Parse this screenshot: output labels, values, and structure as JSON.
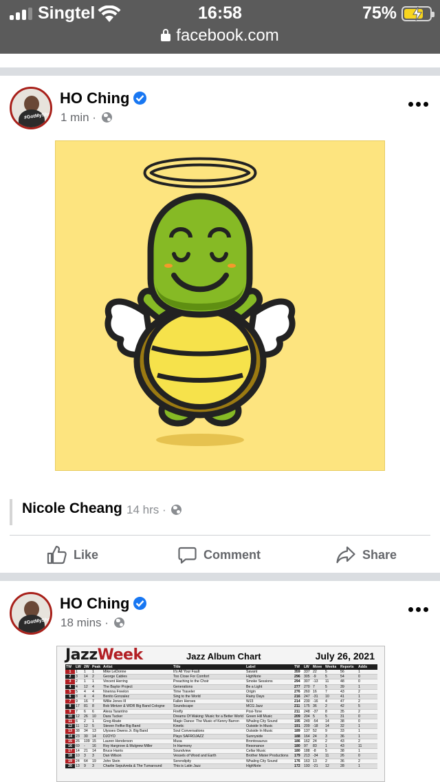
{
  "status_bar": {
    "carrier": "Singtel",
    "time": "16:58",
    "battery_percent": "75%",
    "battery_level": 0.75,
    "url": "facebook.com"
  },
  "posts": [
    {
      "author": "HO Ching",
      "timestamp": "1 min",
      "separator": " · ",
      "image_icon": "turtle-angel-illustration"
    },
    {
      "author": "HO Ching",
      "timestamp": "18 mins",
      "separator": " · "
    }
  ],
  "avatar_tag": "#GotMyShot",
  "comment": {
    "author": "Nicole Cheang",
    "timestamp": "14 hrs",
    "separator": " · "
  },
  "actions": {
    "like": "Like",
    "comment": "Comment",
    "share": "Share"
  },
  "jazz_chart": {
    "logo_part1": "Jazz",
    "logo_part2": "Week",
    "title": "Jazz Album Chart",
    "date": "July 26, 2021",
    "columns": [
      "TW",
      "LW",
      "2W",
      "Peak",
      "Artist",
      "Title",
      "Label",
      "TW",
      "LW",
      "Move",
      "Weeks",
      "Reports",
      "Adds"
    ],
    "rows": [
      [
        "1",
        "1",
        "1",
        "1",
        "Mike LeDonne",
        "It's All Your Fault",
        "Savant",
        "359",
        "337",
        "22",
        "5",
        "56",
        "1"
      ],
      [
        "2",
        "3",
        "14",
        "2",
        "George Cables",
        "Too Close For Comfort",
        "HighNote",
        "296",
        "305",
        "-9",
        "5",
        "54",
        "0"
      ],
      [
        "3",
        "2",
        "1",
        "1",
        "Vincent Herring",
        "Preaching to the Choir",
        "Smoke Sessions",
        "294",
        "307",
        "-13",
        "11",
        "48",
        "0"
      ],
      [
        "4",
        "4",
        "12",
        "4",
        "The Baylor Project",
        "Generations",
        "Be a Light",
        "277",
        "270",
        "7",
        "5",
        "39",
        "1"
      ],
      [
        "5",
        "5",
        "4",
        "4",
        "Nnenna Freelon",
        "Time Traveler",
        "Origin",
        "276",
        "260",
        "16",
        "7",
        "43",
        "2"
      ],
      [
        "6",
        "8",
        "4",
        "4",
        "Benito Gonzalez",
        "Sing to the World",
        "Rainy Days",
        "216",
        "247",
        "-31",
        "10",
        "41",
        "1"
      ],
      [
        "7",
        "9",
        "16",
        "7",
        "Willie Jones III",
        "Fallen Heroes",
        "WJ3",
        "214",
        "230",
        "-16",
        "4",
        "47",
        "2"
      ],
      [
        "8",
        "17",
        "81",
        "8",
        "Bob Mintzer & WDR Big Band Cologne",
        "Soundscape",
        "MCG Jazz",
        "211",
        "175",
        "36",
        "2",
        "42",
        "5"
      ],
      [
        "9",
        "7",
        "6",
        "6",
        "Alexa Tarantino",
        "Firefly",
        "Posi-Tone",
        "211",
        "248",
        "-37",
        "8",
        "35",
        "2"
      ],
      [
        "10",
        "12",
        "26",
        "10",
        "Dara Tucker",
        "Dreams Of Waking: Music for a Better World",
        "Green Hill Music",
        "209",
        "204",
        "5",
        "5",
        "31",
        "0"
      ],
      [
        "11",
        "6",
        "2",
        "1",
        "Greg Abate",
        "Magic Dance: The Music of Kenny Barron",
        "Whaling City Sound",
        "195",
        "249",
        "-54",
        "14",
        "38",
        "0"
      ],
      [
        "12",
        "11",
        "12",
        "5",
        "Steven Feifke Big Band",
        "Kinetic",
        "Outside In Music",
        "191",
        "209",
        "-18",
        "14",
        "32",
        "1"
      ],
      [
        "13",
        "38",
        "34",
        "13",
        "Ulysses Owens Jr. Big Band",
        "Soul Conversations",
        "Outside In Music",
        "189",
        "137",
        "52",
        "9",
        "33",
        "1"
      ],
      [
        "14",
        "23",
        "30",
        "14",
        "DJOYO",
        "Plays SAFROJAZZ",
        "Sunnyside",
        "188",
        "164",
        "24",
        "3",
        "36",
        "1"
      ],
      [
        "15",
        "26",
        "109",
        "15",
        "Lauren Henderson",
        "Musa",
        "Brontosaurus",
        "186",
        "162",
        "24",
        "2",
        "43",
        "2"
      ],
      [
        "16",
        "69",
        "-",
        "16",
        "Roy Hargrove & Mulgrew Miller",
        "In Harmony",
        "Resonance",
        "180",
        "97",
        "83",
        "1",
        "43",
        "11"
      ],
      [
        "17",
        "14",
        "21",
        "14",
        "Bruce Harris",
        "Soundview",
        "Cellar Music",
        "180",
        "188",
        "-8",
        "5",
        "38",
        "1"
      ],
      [
        "18",
        "10",
        "3",
        "3",
        "Dan Wilson",
        "Vessels of Wood and Earth",
        "Brother Mister Productions",
        "179",
        "213",
        "-34",
        "11",
        "26",
        "0"
      ],
      [
        "19",
        "24",
        "64",
        "19",
        "John Stein",
        "Serendipity",
        "Whaling City Sound",
        "176",
        "163",
        "13",
        "2",
        "36",
        "2"
      ],
      [
        "20",
        "13",
        "9",
        "3",
        "Charlie Sepulveda & The Turnaround",
        "This is Latin Jazz",
        "HighNote",
        "172",
        "193",
        "-21",
        "12",
        "28",
        "1"
      ]
    ]
  }
}
